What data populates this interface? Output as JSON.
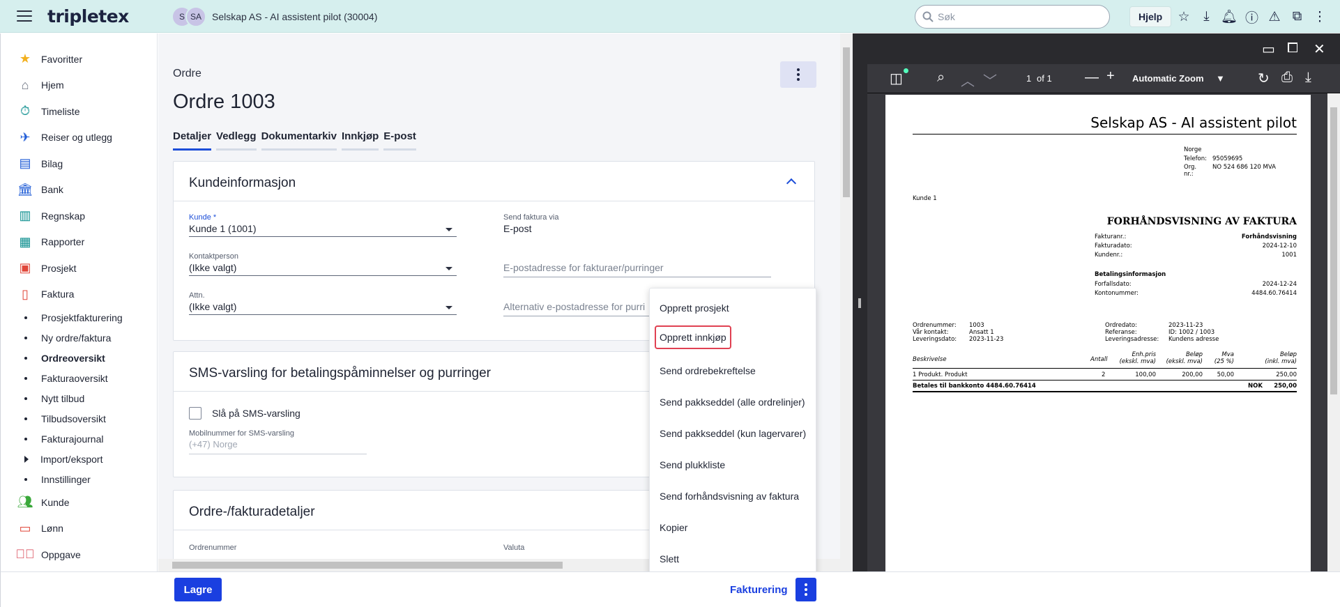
{
  "topbar": {
    "logo": "tripletex",
    "avatars": [
      "S",
      "SA"
    ],
    "company": "Selskap AS - AI assistent pilot (30004)",
    "search_placeholder": "Søk",
    "help_label": "Hjelp",
    "icons": [
      "star-icon",
      "download-icon",
      "bell-icon",
      "alert-circle-icon",
      "warning-icon",
      "external-link-icon",
      "more-vertical-icon"
    ]
  },
  "sidebar": {
    "items": [
      {
        "label": "Favoritter",
        "icon": "star-icon",
        "color": "#f2b01e"
      },
      {
        "label": "Hjem",
        "icon": "home-icon",
        "color": "#6b7280"
      },
      {
        "label": "Timeliste",
        "icon": "stopwatch-icon",
        "color": "#0d8f8f"
      },
      {
        "label": "Reiser og utlegg",
        "icon": "plane-icon",
        "color": "#1e5bd6"
      },
      {
        "label": "Bilag",
        "icon": "document-icon",
        "color": "#1e5bd6"
      },
      {
        "label": "Bank",
        "icon": "bank-icon",
        "color": "#1e5bd6"
      },
      {
        "label": "Regnskap",
        "icon": "book-icon",
        "color": "#0d8f8f"
      },
      {
        "label": "Rapporter",
        "icon": "grid-icon",
        "color": "#0d8f8f"
      },
      {
        "label": "Prosjekt",
        "icon": "briefcase-icon",
        "color": "#e0473a"
      },
      {
        "label": "Faktura",
        "icon": "invoice-icon",
        "color": "#e0473a"
      }
    ],
    "subitems": [
      {
        "label": "Prosjektfakturering"
      },
      {
        "label": "Ny ordre/faktura"
      },
      {
        "label": "Ordreoversikt"
      },
      {
        "label": "Fakturaoversikt"
      },
      {
        "label": "Nytt tilbud"
      },
      {
        "label": "Tilbudsoversikt"
      },
      {
        "label": "Fakturajournal"
      },
      {
        "label": "Import/eksport"
      },
      {
        "label": "Innstillinger"
      }
    ],
    "items_after": [
      {
        "label": "Kunde",
        "icon": "people-icon",
        "color": "#3aa83a"
      },
      {
        "label": "Lønn",
        "icon": "card-icon",
        "color": "#e0473a"
      },
      {
        "label": "Oppgave",
        "icon": "check-circle-icon",
        "color": "#d63a4a"
      }
    ]
  },
  "main": {
    "breadcrumb": "Ordre",
    "title": "Ordre 1003",
    "tabs": [
      "Detaljer",
      "Vedlegg",
      "Dokumentarkiv",
      "Innkjøp",
      "E-post"
    ],
    "customer_card": {
      "title": "Kundeinformasjon",
      "kunde_label": "Kunde *",
      "kunde_value": "Kunde 1 (1001)",
      "send_label": "Send faktura via",
      "send_value": "E-post",
      "kontakt_label": "Kontaktperson",
      "kontakt_value": "(Ikke valgt)",
      "email_placeholder": "E-postadresse for fakturaer/purringer",
      "attn_label": "Attn.",
      "attn_value": "(Ikke valgt)",
      "alt_email_placeholder": "Alternativ e-postadresse for purri"
    },
    "sms_card": {
      "title": "SMS-varsling for betalingspåminnelser og purringer",
      "checkbox_label": "Slå på SMS-varsling",
      "mobile_label": "Mobilnummer for SMS-varsling",
      "mobile_placeholder": "(+47) Norge"
    },
    "order_card": {
      "title": "Ordre-/fakturadetaljer",
      "ordernr_label": "Ordrenummer",
      "valuta_label": "Valuta"
    }
  },
  "menu": {
    "items": [
      "Opprett prosjekt",
      "Opprett innkjøp",
      "Send ordrebekreftelse",
      "Send pakkseddel (alle ordrelinjer)",
      "Send pakkseddel (kun lagervarer)",
      "Send plukkliste",
      "Send forhåndsvisning av faktura",
      "Kopier",
      "Slett"
    ],
    "highlight_color": "#e04152"
  },
  "bottombar": {
    "save_label": "Lagre",
    "invoice_label": "Fakturering"
  },
  "pdf": {
    "page_indicator": "1",
    "page_total": "of 1",
    "zoom": "Automatic Zoom",
    "doc": {
      "company": "Selskap AS - AI assistent pilot",
      "country": "Norge",
      "phone_label": "Telefon:",
      "phone": "95059695",
      "org_label_1": "Org.",
      "org_label_2": "nr.:",
      "org": "NO 524 686 120 MVA",
      "customer": "Kunde 1",
      "heading": "FORHÅNDSVISNING AV FAKTURA",
      "invoice_no_label": "Fakturanr.:",
      "invoice_no": "Forhåndsvisning",
      "invoice_date_label": "Fakturadato:",
      "invoice_date": "2024-12-10",
      "customer_no_label": "Kundenr.:",
      "customer_no": "1001",
      "payment_heading": "Betalingsinformasjon",
      "due_label": "Forfallsdato:",
      "due": "2024-12-24",
      "account_label": "Kontonummer:",
      "account": "4484.60.76414",
      "order_no_label": "Ordrenummer:",
      "order_no": "1003",
      "contact_label": "Vår kontakt:",
      "contact": "Ansatt 1",
      "delivery_date_label": "Leveringsdato:",
      "delivery_date": "2023-11-23",
      "order_date_label": "Ordredato:",
      "order_date": "2023-11-23",
      "ref_label": "Referanse:",
      "ref": "ID: 1002 / 1003",
      "delivery_addr_label": "Leveringsadresse:",
      "delivery_addr": "Kundens adresse",
      "col_desc": "Beskrivelse",
      "col_qty": "Antall",
      "col_unit_1": "Enh.pris",
      "col_unit_2": "(ekskl. mva)",
      "col_amount_1": "Beløp",
      "col_amount_2": "(ekskl. mva)",
      "col_vat_1": "Mva",
      "col_vat_2": "(25 %)",
      "col_total_1": "Beløp",
      "col_total_2": "(inkl. mva)",
      "row_desc": "1 Produkt. Produkt",
      "row_qty": "2",
      "row_unit": "100,00",
      "row_amount": "200,00",
      "row_vat": "50,00",
      "row_total": "250,00",
      "pay_line": "Betales til bankkonto 4484.60.76414",
      "pay_currency": "NOK",
      "pay_total": "250,00"
    }
  }
}
